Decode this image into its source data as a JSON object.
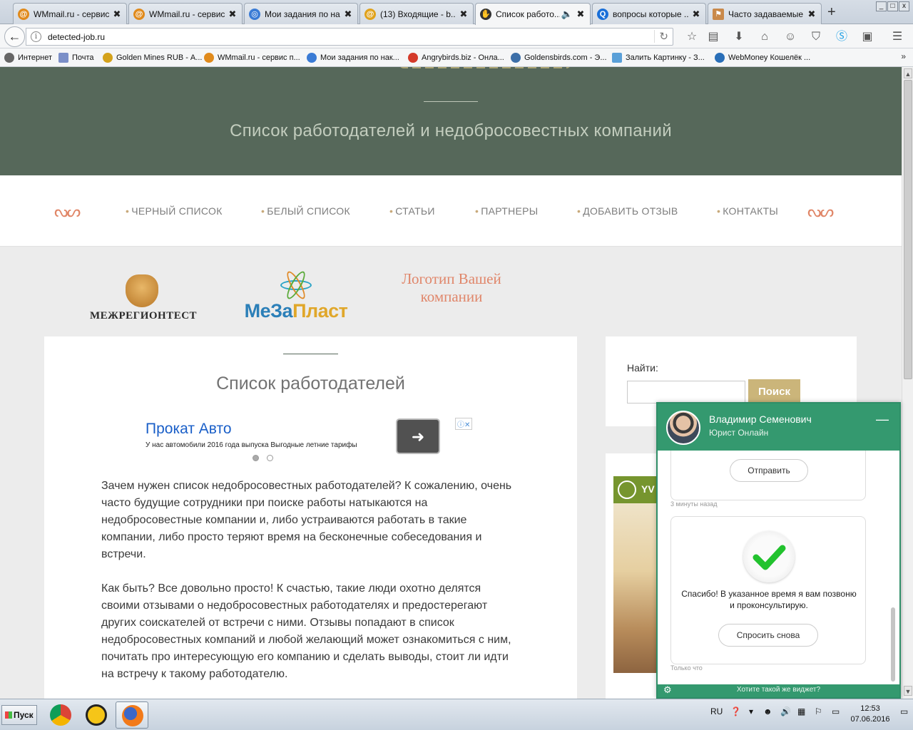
{
  "browser": {
    "tabs": [
      {
        "title": "WMmail.ru - сервис...",
        "icon_color": "#e08a1c",
        "close": "✖"
      },
      {
        "title": "WMmail.ru - сервис...",
        "icon_color": "#e08a1c",
        "close": "✖"
      },
      {
        "title": "Мои задания по на...",
        "icon_color": "#3a7bd5",
        "close": "✖"
      },
      {
        "title": "(13) Входящие - b...",
        "icon_color": "#e0a21c",
        "close": "✖"
      },
      {
        "title": "Список работо...",
        "icon_color": "#333333",
        "close": "✖",
        "active": true
      },
      {
        "title": "вопросы которые ...",
        "icon_color": "#1a6fd8",
        "close": "✖"
      },
      {
        "title": "Часто задаваемые...",
        "icon_color": "#c9894a",
        "close": "✖"
      }
    ],
    "new_tab_glyph": "+",
    "url": "detected-job.ru",
    "bookmarks": [
      {
        "label": "Интернет",
        "icon_color": "#666666"
      },
      {
        "label": "Почта",
        "icon_color": "#7b8fc8"
      },
      {
        "label": "Golden Mines RUB - А...",
        "icon_color": "#d4a21b"
      },
      {
        "label": "WMmail.ru - сервис п...",
        "icon_color": "#e08a1c"
      },
      {
        "label": "Мои задания по нак...",
        "icon_color": "#3a7bd5"
      },
      {
        "label": "Angrybirds.biz - Онла...",
        "icon_color": "#d43a2a"
      },
      {
        "label": "Goldensbirds.com - Э...",
        "icon_color": "#3d6fa8"
      },
      {
        "label": "Залить Картинку - З...",
        "icon_color": "#5aa0d8"
      },
      {
        "label": "WebMoney Кошелёк ...",
        "icon_color": "#2a6fb8"
      }
    ],
    "bookmarks_more": "»"
  },
  "site": {
    "tagline": "Список работодателей и недобросовестных компаний",
    "menu": [
      {
        "label": "ЧЕРНЫЙ СПИСОК"
      },
      {
        "label": "БЕЛЫЙ СПИСОК"
      },
      {
        "label": "СТАТЬИ"
      },
      {
        "label": "ПАРТНЕРЫ"
      },
      {
        "label": "ДОБАВИТЬ ОТЗЫВ"
      },
      {
        "label": "КОНТАКТЫ"
      }
    ],
    "menu_bullet": "•",
    "ornament": "ᔓᔕ",
    "partners": {
      "mezh": "МЕЖРЕГИОНТЕСТ",
      "meza_a": "МеЗа",
      "meza_b": "Пласт",
      "yours": "Логотип Вашей компании"
    },
    "page_title": "Список работодателей",
    "ad": {
      "title": "Прокат Авто",
      "text": "У нас автомобили 2016 года выпуска Выгодные летние тарифы",
      "go_glyph": "➜",
      "badge": "ⓘ✕"
    },
    "paragraphs": [
      "Зачем нужен список недобросовестных работодателей? К сожалению, очень часто будущие сотрудники при поиске работы натыкаются на недобросовестные компании и, либо устраиваются работать в такие компании, либо просто теряют время на бесконечные собеседования и встречи.",
      "Как быть? Все довольно просто! К счастью, такие люди охотно делятся своими отзывами о недобросовестных работодателях и предостерегают других соискателей от встречи с ними. Отзывы попадают в список недобросовестных компаний и любой желающий может ознакомиться с ним, почитать про интересующую его компанию и сделать выводы, стоит ли идти на встречу к такому работодателю."
    ],
    "search": {
      "label": "Найти:",
      "value": "",
      "button": "Поиск"
    },
    "sidebar_ad_text": "YV"
  },
  "chat": {
    "name": "Владимир Семенович",
    "role": "Юрист Онлайн",
    "minimize": "—",
    "send_button": "Отправить",
    "timestamp_1": "3 минуты назад",
    "message": "Спасибо! В указанное время я вам позвоню и проконсультирую.",
    "ask_again_button": "Спросить снова",
    "timestamp_2": "Только что",
    "footer_link": "Хотите такой же виджет?",
    "accent": "#34996f"
  },
  "taskbar": {
    "start": "Пуск",
    "language": "RU",
    "time": "12:53",
    "date": "07.06.2016"
  }
}
